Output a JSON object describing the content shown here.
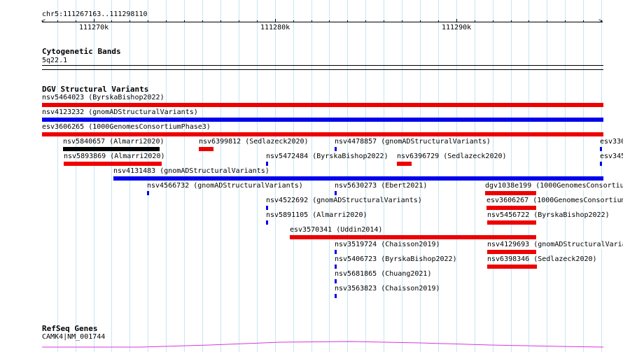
{
  "ruler": {
    "location": "chr5:111267163..111298110",
    "labels": [
      {
        "text": "111270k",
        "pos": 111270000
      },
      {
        "text": "111280k",
        "pos": 111280000
      },
      {
        "text": "111290k",
        "pos": 111290000
      }
    ]
  },
  "view": {
    "start": 111267163,
    "end": 111298110
  },
  "tracks": {
    "cytoband": {
      "title": "Cytogenetic Bands",
      "band": "5q22.1"
    },
    "dgv": {
      "title": "DGV Structural Variants"
    },
    "refseq": {
      "title": "RefSeq Genes",
      "gene": "CAMK4|NM_001744"
    }
  },
  "colors": {
    "red": "#ee0000",
    "blue": "#0000ee",
    "black": "#000000",
    "magenta": "#dd33dd",
    "grid": "#c5e6f3"
  },
  "variants": [
    {
      "label": "nsv5464023 (ByrskaBishop2022)",
      "color": "red"
    },
    {
      "label": "nsv4123232 (gnomADStructuralVariants)",
      "color": "blue"
    },
    {
      "label": "esv3606265 (1000GenomesConsortiumPhase3)",
      "color": "red"
    },
    {
      "label": "nsv5840657 (Almarri2020)",
      "color": "black"
    },
    {
      "label": "nsv6399812 (Sedlazeck2020)",
      "color": "red"
    },
    {
      "label": "nsv4478857 (gnomADStructuralVariants)",
      "color": "blue"
    },
    {
      "label": "esv330",
      "color": "blue"
    },
    {
      "label": "nsv5893869 (Almarri2020)",
      "color": "red"
    },
    {
      "label": "nsv5472484 (ByrskaBishop2022)",
      "color": "blue"
    },
    {
      "label": "nsv6396729 (Sedlazeck2020)",
      "color": "red"
    },
    {
      "label": "esv345",
      "color": "blue"
    },
    {
      "label": "nsv4131483 (gnomADStructuralVariants)",
      "color": "blue"
    },
    {
      "label": "nsv4566732 (gnomADStructuralVariants)",
      "color": "blue"
    },
    {
      "label": "nsv5630273 (Ebert2021)",
      "color": "blue"
    },
    {
      "label": "dgv1038e199 (1000GenomesConsortiu",
      "color": "red"
    },
    {
      "label": "nsv4522692 (gnomADStructuralVariants)",
      "color": "blue"
    },
    {
      "label": "esv3606267 (1000GenomesConsortium",
      "color": "red"
    },
    {
      "label": "nsv5891105 (Almarri2020)",
      "color": "blue"
    },
    {
      "label": "nsv5456722 (ByrskaBishop2022)",
      "color": "red"
    },
    {
      "label": "esv3570341 (Uddin2014)",
      "color": "red"
    },
    {
      "label": "nsv3519724 (Chaisson2019)",
      "color": "blue"
    },
    {
      "label": "nsv4129693 (gnomADStructuralVaria",
      "color": "red"
    },
    {
      "label": "nsv5406723 (ByrskaBishop2022)",
      "color": "blue"
    },
    {
      "label": "nsv6398346 (Sedlazeck2020)",
      "color": "red"
    },
    {
      "label": "nsv5681865 (Chuang2021)",
      "color": "blue"
    },
    {
      "label": "nsv3563823 (Chaisson2019)",
      "color": "blue"
    }
  ]
}
